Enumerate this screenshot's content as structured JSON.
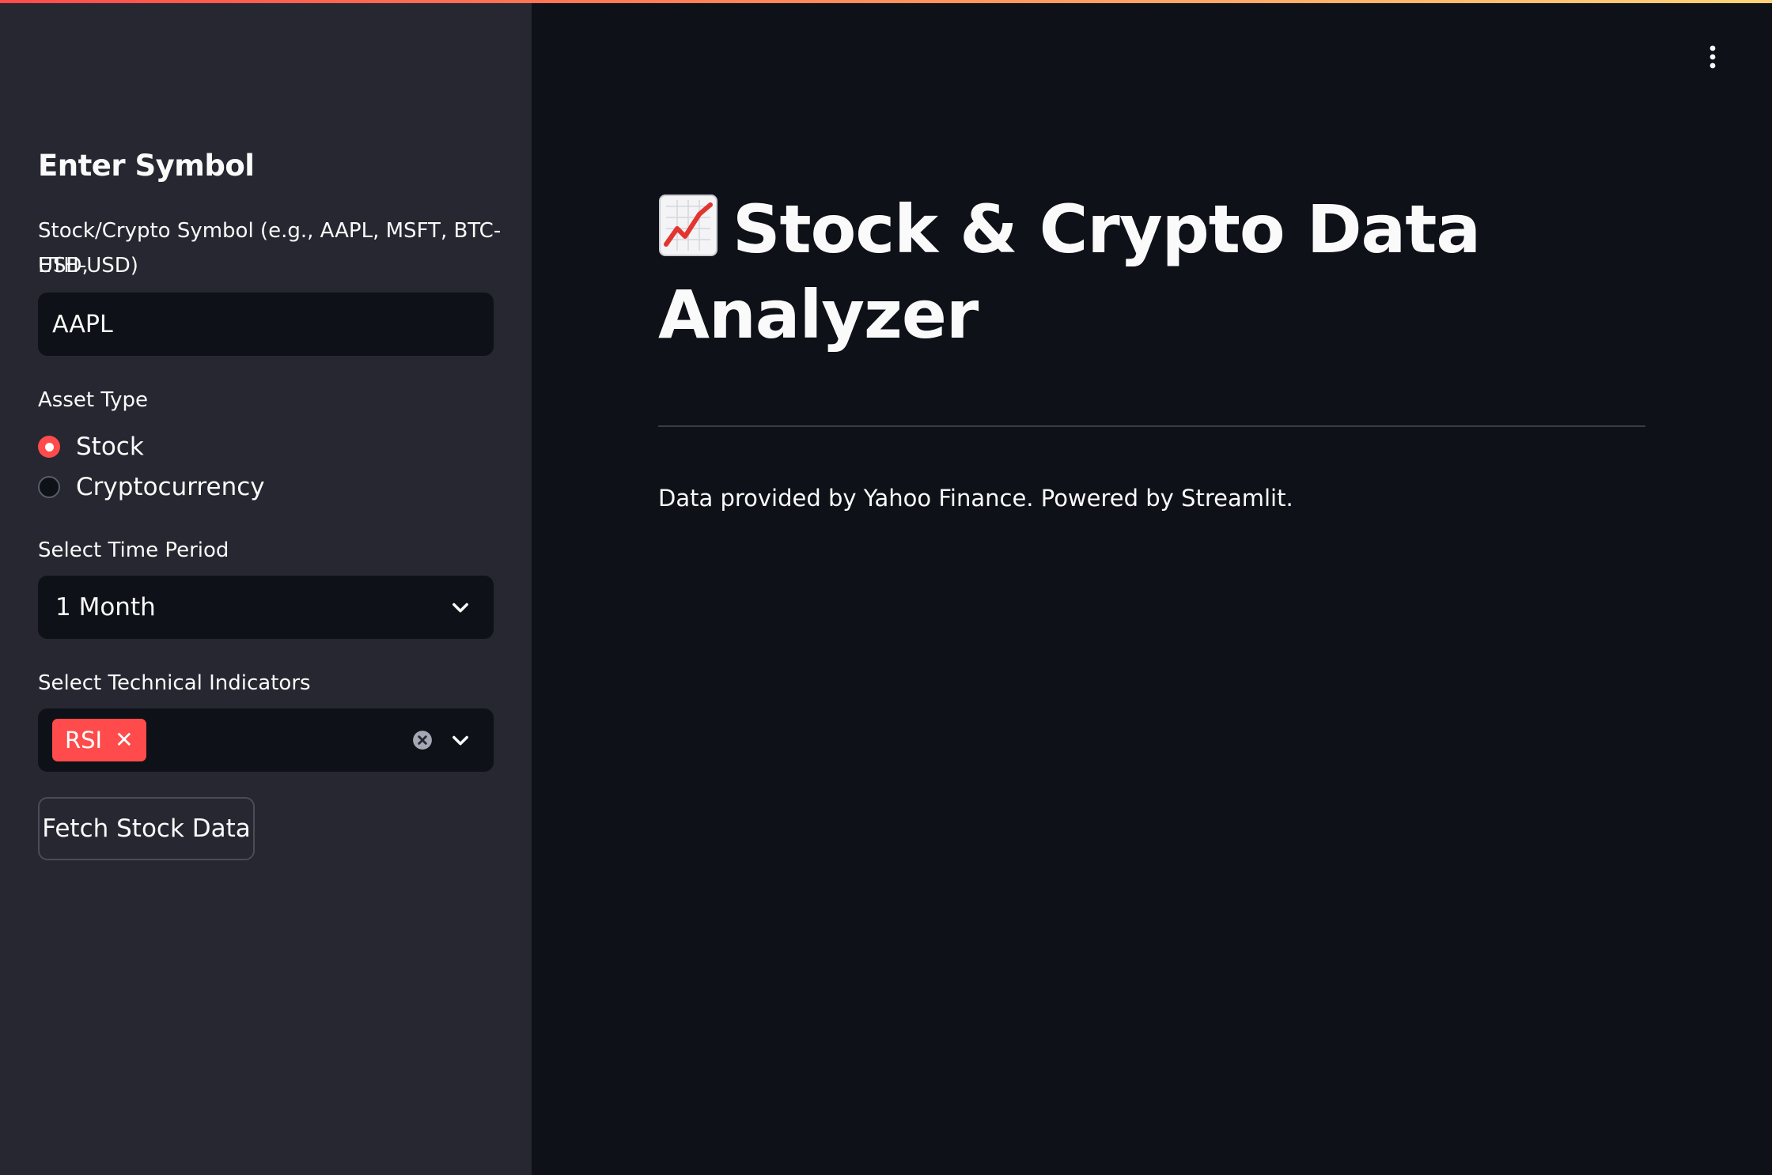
{
  "sidebar": {
    "heading": "Enter Symbol",
    "symbol_label": "Stock/Crypto Symbol (e.g., AAPL, MSFT, BTC-USD,",
    "symbol_label_line2": "ETH-USD)",
    "symbol_value": "AAPL",
    "asset_type_label": "Asset Type",
    "asset_options": [
      "Stock",
      "Cryptocurrency"
    ],
    "asset_selected": "Stock",
    "period_label": "Select Time Period",
    "period_value": "1 Month",
    "indicators_label": "Select Technical Indicators",
    "indicators_selected": [
      "RSI"
    ],
    "fetch_button": "Fetch Stock Data"
  },
  "main": {
    "title": "Stock & Crypto Data Analyzer",
    "title_icon": "chart-increasing-emoji",
    "caption": "Data provided by Yahoo Finance. Powered by Streamlit."
  },
  "colors": {
    "accent": "#ff4b4b",
    "sidebar_bg": "#262730",
    "main_bg": "#0e1117",
    "text": "#fafafa"
  }
}
